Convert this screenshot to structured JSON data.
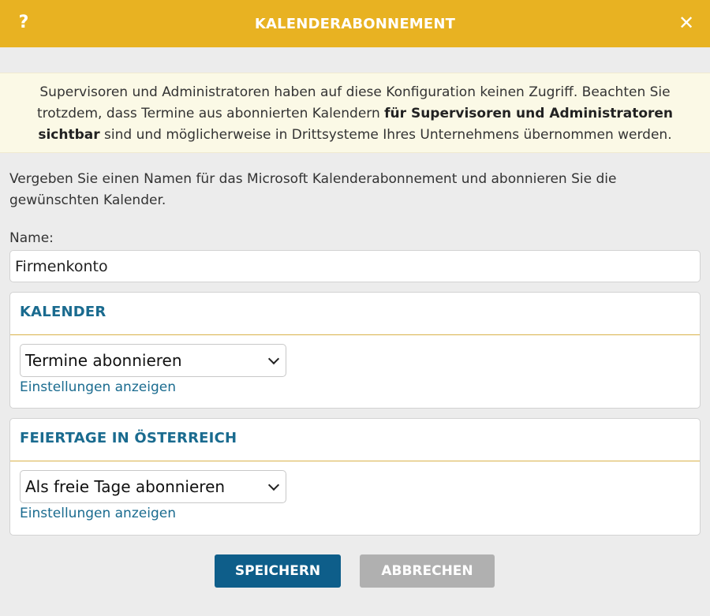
{
  "header": {
    "title": "KALENDERABONNEMENT",
    "help_label": "?",
    "close_label": "✕",
    "color": "#e8b222"
  },
  "notice": {
    "text_part1": "Supervisoren und Administratoren haben auf diese Konfiguration keinen Zugriff. Beachten Sie trotzdem, dass Termine aus abonnierten Kalendern ",
    "text_bold": "für Supervisoren und Administratoren sichtbar",
    "text_part2": " sind und möglicherweise in Drittsysteme Ihres Unternehmens übernommen werden."
  },
  "intro": "Vergeben Sie einen Namen für das Microsoft Kalenderabonnement und abonnieren Sie die gewünschten Kalender.",
  "name_field": {
    "label": "Name:",
    "value": "Firmenkonto"
  },
  "panels": [
    {
      "title": "KALENDER",
      "select_value": "Termine abonnieren",
      "link": "Einstellungen anzeigen"
    },
    {
      "title": "FEIERTAGE IN ÖSTERREICH",
      "select_value": "Als freie Tage abonnieren",
      "link": "Einstellungen anzeigen"
    }
  ],
  "buttons": {
    "save": "SPEICHERN",
    "cancel": "ABBRECHEN"
  },
  "colors": {
    "accent": "#e8b222",
    "primary_button": "#0e5e8a",
    "secondary_button": "#b0b0b0",
    "link": "#1a6b8f"
  }
}
